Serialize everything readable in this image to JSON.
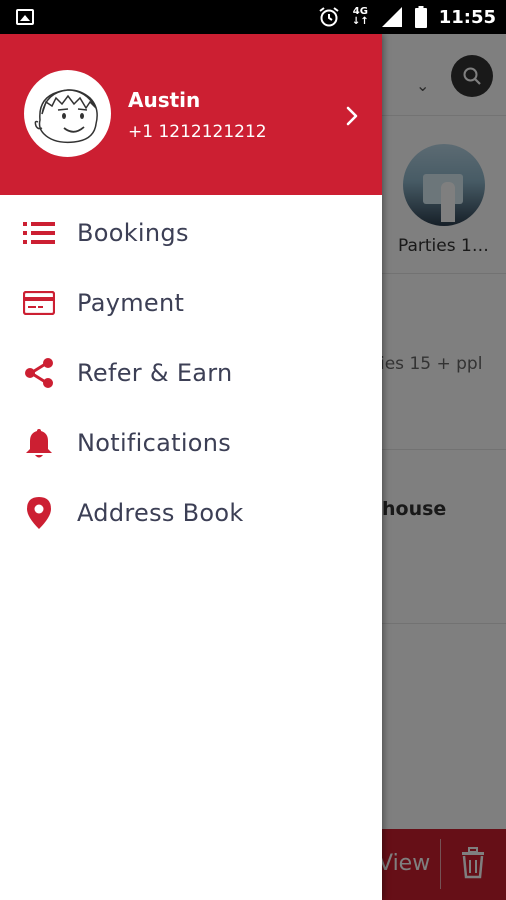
{
  "status_bar": {
    "network": "4G",
    "time": "11:55"
  },
  "profile": {
    "name": "Austin",
    "phone": "+1 1212121212"
  },
  "menu": [
    {
      "label": "Bookings",
      "icon": "list-icon"
    },
    {
      "label": "Payment",
      "icon": "credit-card-icon"
    },
    {
      "label": "Refer & Earn",
      "icon": "share-icon"
    },
    {
      "label": "Notifications",
      "icon": "bell-icon"
    },
    {
      "label": "Address Book",
      "icon": "location-pin-icon"
    }
  ],
  "background": {
    "card_label": "Parties 1…",
    "row2_text": "ies 15 + ppl",
    "row3_text": "house",
    "bottom_view_label": "View"
  },
  "colors": {
    "brand_red": "#cc1f32",
    "menu_text": "#3c3f55"
  }
}
